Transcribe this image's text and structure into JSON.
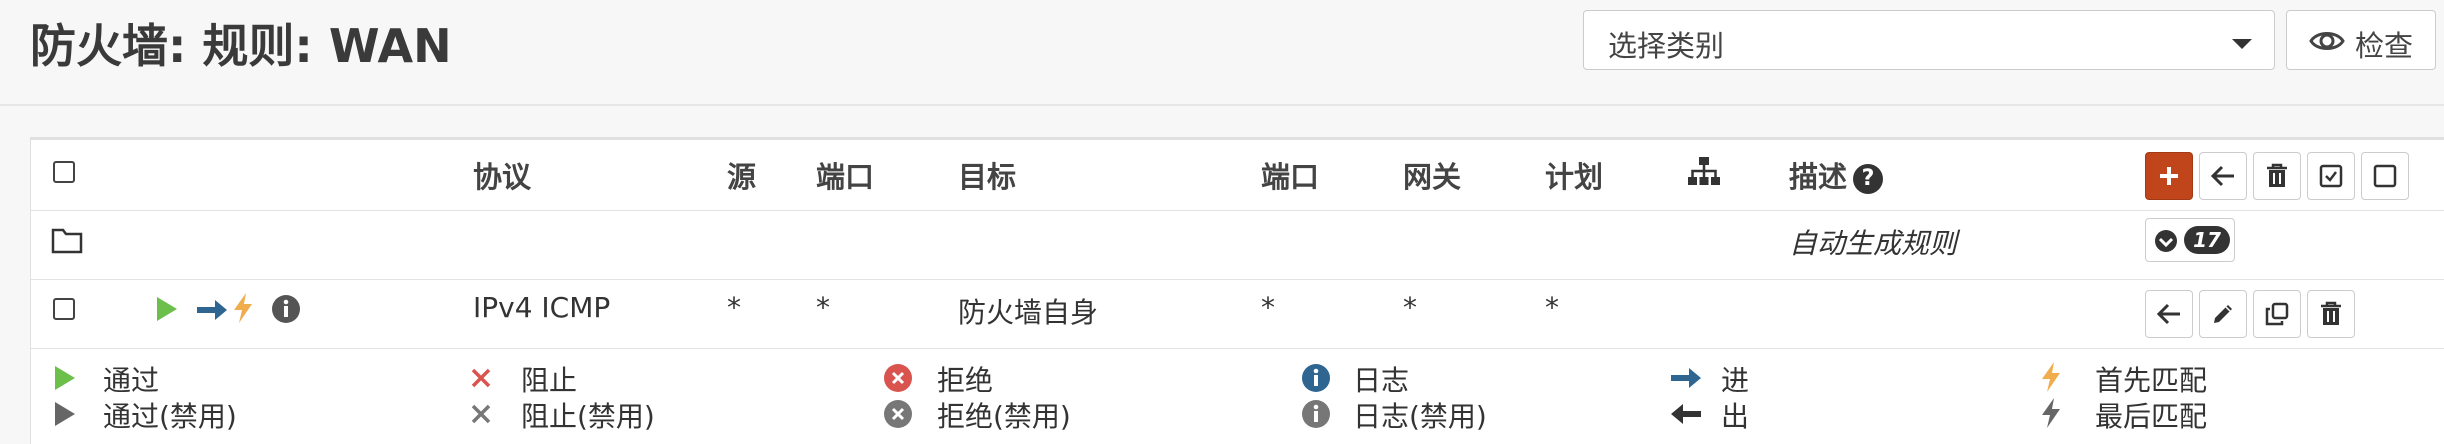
{
  "page": {
    "title": "防火墙: 规则: WAN"
  },
  "toolbar": {
    "category_select": {
      "selected": "选择类别"
    },
    "inspect_label": "检查"
  },
  "table": {
    "headers": {
      "protocol": "协议",
      "source": "源",
      "src_port": "端口",
      "destination": "目标",
      "dst_port": "端口",
      "gateway": "网关",
      "schedule": "计划",
      "description": "描述",
      "description_help": "?"
    },
    "group_row": {
      "description": "自动生成规则",
      "count": "17"
    },
    "rules": [
      {
        "protocol": "IPv4 ICMP",
        "source": "*",
        "src_port": "*",
        "destination": "防火墙自身",
        "dst_port": "*",
        "gateway": "*",
        "schedule": "*"
      }
    ]
  },
  "legend": {
    "pass": "通过",
    "pass_disabled": "通过(禁用)",
    "block": "阻止",
    "block_disabled": "阻止(禁用)",
    "reject": "拒绝",
    "reject_disabled": "拒绝(禁用)",
    "log": "日志",
    "log_disabled": "日志(禁用)",
    "in": "进",
    "out": "出",
    "first_match": "首先匹配",
    "last_match": "最后匹配"
  },
  "colors": {
    "pass": "#6cbf4b",
    "block": "#d9534f",
    "info": "#2e6591",
    "quick": "#f0ad4e",
    "add_button": "#c0451a"
  }
}
